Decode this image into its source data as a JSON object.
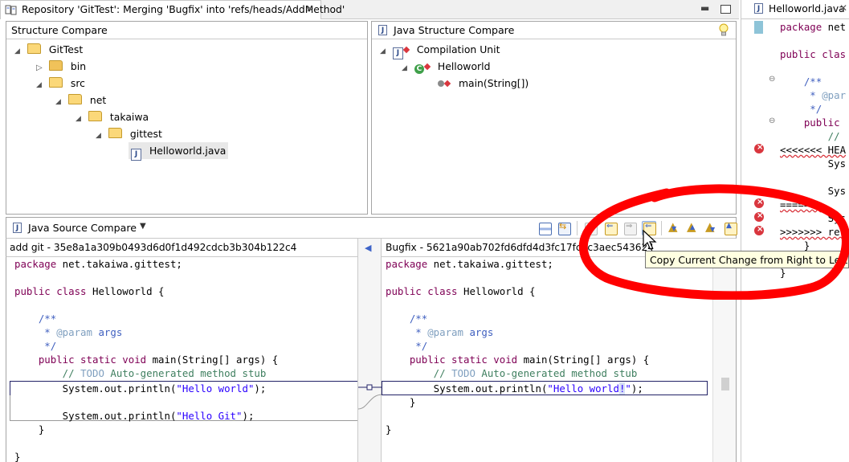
{
  "editor": {
    "tab_title": "Repository 'GitTest': Merging 'Bugfix' into 'refs/heads/AddMethod'",
    "tab_close": "✕"
  },
  "structure_compare": {
    "title": "Structure Compare",
    "tree": [
      {
        "label": "GitTest",
        "depth": 0,
        "kind": "project",
        "expanded": true
      },
      {
        "label": "bin",
        "depth": 1,
        "kind": "folder",
        "expanded": false
      },
      {
        "label": "src",
        "depth": 1,
        "kind": "folder",
        "expanded": true
      },
      {
        "label": "net",
        "depth": 2,
        "kind": "folder",
        "expanded": true
      },
      {
        "label": "takaiwa",
        "depth": 3,
        "kind": "folder",
        "expanded": true
      },
      {
        "label": "gittest",
        "depth": 4,
        "kind": "folder",
        "expanded": true
      },
      {
        "label": "Helloworld.java",
        "depth": 5,
        "kind": "file",
        "selected": true
      }
    ]
  },
  "java_structure_compare": {
    "title": "Java Structure Compare",
    "tree": [
      {
        "label": "Compilation Unit",
        "depth": 0
      },
      {
        "label": "Helloworld",
        "depth": 1
      },
      {
        "label": "main(String[])",
        "depth": 2
      }
    ]
  },
  "source_compare": {
    "title": "Java Source Compare",
    "left_header": "add git - 35e8a1a309b0493d6d0f1d492cdcb3b304b122c4",
    "right_header": "Bugfix - 5621a90ab702fd6dfd4d3fc17fc1c3aec543624",
    "tooltip": "Copy Current Change from Right to Left",
    "toolbar_icons": [
      "layout-icon",
      "swap-sides-icon",
      "copy-all-left-to-right-icon",
      "copy-current-left-to-right-icon",
      "copy-all-right-to-left-icon",
      "copy-current-right-to-left-icon",
      "next-difference-icon",
      "previous-difference-icon",
      "next-change-icon",
      "previous-change-icon"
    ],
    "left_code": [
      "package net.takaiwa.gittest;",
      "",
      "public class Helloworld {",
      "",
      "    /**",
      "     * @param args",
      "     */",
      "    public static void main(String[] args) {",
      "        // TODO Auto-generated method stub",
      "        System.out.println(\"Hello world\");",
      "",
      "        System.out.println(\"Hello Git\");",
      "    }",
      "",
      "}"
    ],
    "right_code": [
      "package net.takaiwa.gittest;",
      "",
      "public class Helloworld {",
      "",
      "    /**",
      "     * @param args",
      "     */",
      "    public static void main(String[] args) {",
      "        // TODO Auto-generated method stub",
      "        System.out.println(\"Hello world!\");",
      "    }",
      "",
      "}"
    ]
  },
  "side_editor": {
    "tab_title": "Helloworld.java",
    "tab_close": "✕",
    "lines": [
      "package net",
      "",
      "public clas",
      "",
      "    /**",
      "     * @par",
      "     */",
      "    public",
      "        //",
      "<<<<<<< HEA",
      "        Sys",
      "",
      "        Sys",
      "=======",
      "        Sys",
      ">>>>>>> ref",
      "    }",
      "}"
    ]
  },
  "colors": {
    "accent_blue": "#3e64c8",
    "conflict_red": "#d9534f",
    "annotation_red": "#ff0000"
  }
}
